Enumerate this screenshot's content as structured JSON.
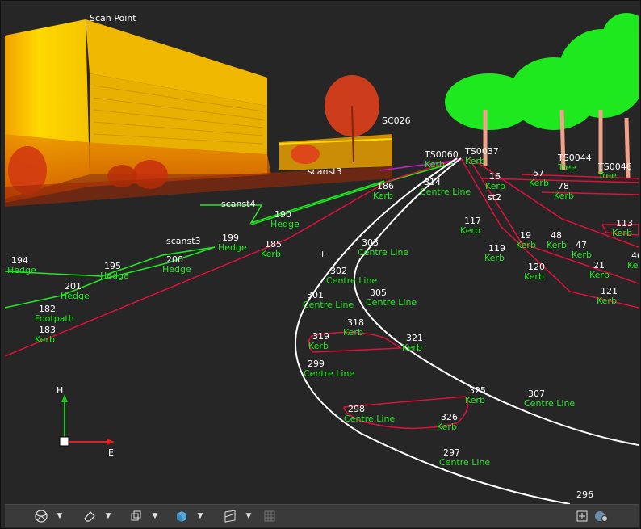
{
  "viewport": {
    "scan_point_label": "Scan Point",
    "axis": {
      "vertical": "H",
      "horizontal": "E"
    },
    "scan_labels": [
      "scanst3",
      "scanst4",
      "scanst3",
      "st2"
    ],
    "station_labels": [
      "TS0060",
      "TS0037",
      "TS0044",
      "TS0046",
      "SC026"
    ],
    "points": [
      {
        "id": "194",
        "code": "Hedge"
      },
      {
        "id": "195",
        "code": "Hedge"
      },
      {
        "id": "201",
        "code": "Hedge"
      },
      {
        "id": "182",
        "code": "Footpath"
      },
      {
        "id": "183",
        "code": "Kerb"
      },
      {
        "id": "199",
        "code": "Hedge"
      },
      {
        "id": "200",
        "code": "Hedge"
      },
      {
        "id": "190",
        "code": "Hedge"
      },
      {
        "id": "185",
        "code": "Kerb"
      },
      {
        "id": "186",
        "code": "Kerb"
      },
      {
        "id": "314",
        "code": "Centre Line"
      },
      {
        "id": "303",
        "code": "Centre Line"
      },
      {
        "id": "302",
        "code": "Centre Line"
      },
      {
        "id": "301",
        "code": "Centre Line"
      },
      {
        "id": "305",
        "code": "Centre Line"
      },
      {
        "id": "318",
        "code": "Kerb"
      },
      {
        "id": "319",
        "code": "Kerb"
      },
      {
        "id": "321",
        "code": "Kerb"
      },
      {
        "id": "299",
        "code": "Centre Line"
      },
      {
        "id": "298",
        "code": "Centre Line"
      },
      {
        "id": "325",
        "code": "Kerb"
      },
      {
        "id": "326",
        "code": "Kerb"
      },
      {
        "id": "307",
        "code": "Centre Line"
      },
      {
        "id": "297",
        "code": "Centre Line"
      },
      {
        "id": "296",
        "code": ""
      },
      {
        "id": "117",
        "code": "Kerb"
      },
      {
        "id": "119",
        "code": "Kerb"
      },
      {
        "id": "120",
        "code": "Kerb"
      },
      {
        "id": "19",
        "code": "Kerb"
      },
      {
        "id": "48",
        "code": "Kerb"
      },
      {
        "id": "47",
        "code": "Kerb"
      },
      {
        "id": "21",
        "code": "Kerb"
      },
      {
        "id": "121",
        "code": "Kerb"
      },
      {
        "id": "113",
        "code": "Kerb"
      },
      {
        "id": "46",
        "code": "Kerb"
      },
      {
        "id": "16",
        "code": "Kerb"
      },
      {
        "id": "57",
        "code": "Kerb"
      },
      {
        "id": "78",
        "code": "Kerb"
      }
    ],
    "extra_codes": [
      "Kerb",
      "Kerb",
      "Tree",
      "Tree",
      "Kerb"
    ]
  },
  "toolbar": {
    "buttons": [
      "view-mode-icon",
      "eraser-icon",
      "cube-frame-icon",
      "solid-cube-icon",
      "clip-plane-icon",
      "grid-icon",
      "add-panel-icon",
      "globe-gear-icon"
    ]
  },
  "colors": {
    "background": "#262626",
    "label_id": "#ffffff",
    "label_code": "#22e822",
    "kerb_line": "#e0103c",
    "hedge_line": "#22e822",
    "centre_line": "#ffffff",
    "building": "#f5d000",
    "tree_foliage": "#1ee81e"
  }
}
